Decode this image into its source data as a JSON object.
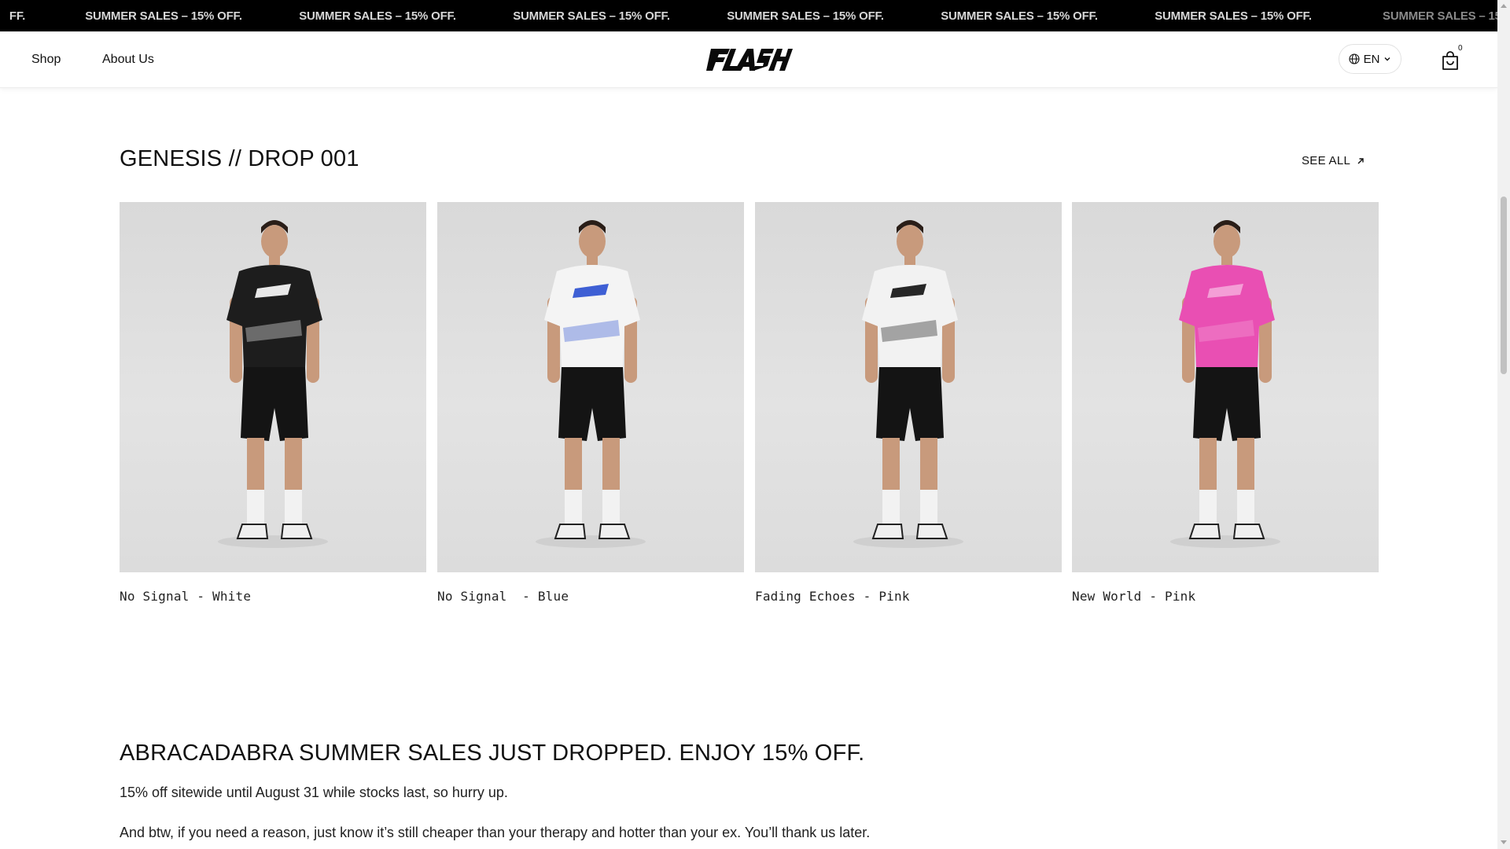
{
  "announcement": {
    "text": "SUMMER SALES – 15% OFF.",
    "partial_start": "FF.",
    "partial_end": "SUMMER SALES – 15%",
    "background": "#000000"
  },
  "header": {
    "nav": {
      "shop": "Shop",
      "about": "About Us"
    },
    "logo_text": "FLASH",
    "language": "EN",
    "cart_count": "0"
  },
  "collection": {
    "title": "GENESIS // DROP 001",
    "see_all": "SEE ALL",
    "products": [
      {
        "name": "No Signal - White",
        "jersey_color": "#1d1d1d",
        "accent": "#ffffff"
      },
      {
        "name": "No Signal  - Blue",
        "jersey_color": "#f4f4f4",
        "accent": "#2a4fd0"
      },
      {
        "name": "Fading Echoes - Pink",
        "jersey_color": "#f2f2f2",
        "accent": "#111111"
      },
      {
        "name": "New World - Pink",
        "jersey_color": "#e94fb3",
        "accent": "#f5a6d9"
      }
    ]
  },
  "promo": {
    "title": "ABRACADABRA SUMMER SALES JUST DROPPED. ENJOY 15% OFF.",
    "line1": "15% off sitewide until August 31 while stocks last, so hurry up.",
    "line2": "And btw, if you need a reason, just know it’s still cheaper than your therapy and hotter than your ex. You’ll thank us later."
  }
}
